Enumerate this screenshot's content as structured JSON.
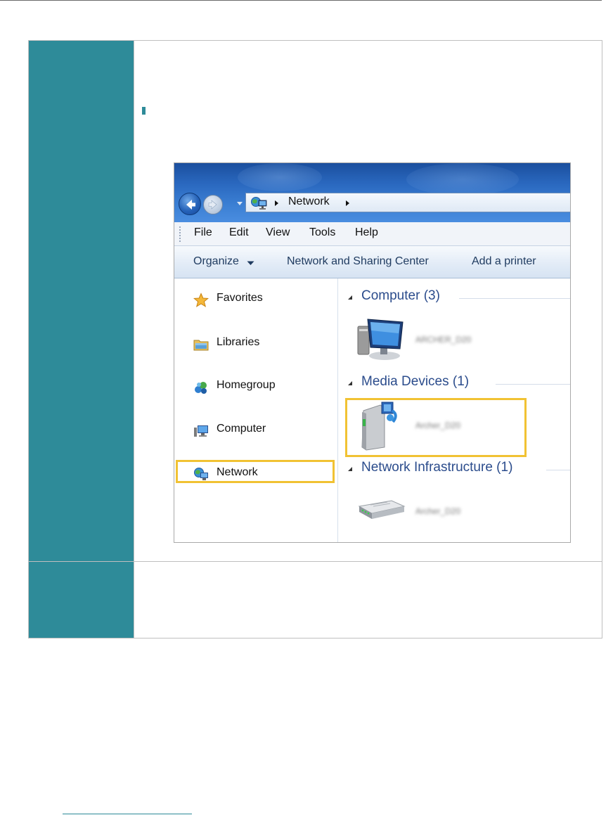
{
  "explorer": {
    "address": {
      "location": "Network"
    },
    "menu": [
      "File",
      "Edit",
      "View",
      "Tools",
      "Help"
    ],
    "toolbar": {
      "organize": "Organize",
      "network_sharing": "Network and Sharing Center",
      "add_printer": "Add a printer"
    },
    "nav": {
      "favorites": "Favorites",
      "libraries": "Libraries",
      "homegroup": "Homegroup",
      "computer": "Computer",
      "network": "Network"
    },
    "groups": {
      "computer": {
        "title": "Computer (3)",
        "device": "ARCHER_D20"
      },
      "media": {
        "title": "Media Devices (1)",
        "device": "Archer_D20"
      },
      "infrastructure": {
        "title": "Network Infrastructure (1)",
        "device": "Archer_D20"
      }
    },
    "highlight_color": "#f1c233"
  },
  "colors": {
    "teal": "#2e8b99",
    "title_blue": "#2b4c8c"
  }
}
